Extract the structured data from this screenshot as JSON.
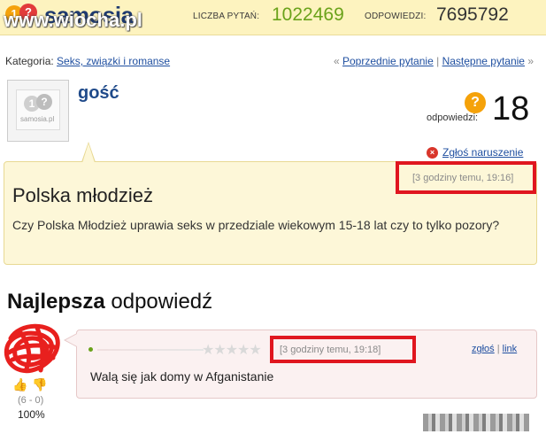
{
  "header": {
    "logo_badges": [
      "1",
      "?"
    ],
    "logo_text": "samosia",
    "watermark": "www.wiocha.pl",
    "questions_label": "LICZBA PYTAŃ:",
    "questions_count": "1022469",
    "answers_label": "ODPOWIEDZI:",
    "answers_count": "7695792"
  },
  "category": {
    "label": "Kategoria:",
    "value": "Seks, związki i romanse"
  },
  "nav": {
    "prefix": "«",
    "prev": "Poprzednie pytanie",
    "separator": "|",
    "next": "Następne pytanie",
    "suffix": "»"
  },
  "asker": {
    "name": "gość",
    "avatar_text": "samosia.pl",
    "avatar_badges": [
      "1",
      "?"
    ]
  },
  "answers": {
    "icon": "?",
    "label": "odpowiedzi:",
    "count": "18"
  },
  "report": {
    "icon": "×",
    "label": "Zgłoś naruszenie"
  },
  "question": {
    "timestamp": "[3 godziny temu, 19:16]",
    "title": "Polska młodzież",
    "body": "Czy Polska Młodzież uprawia seks w przedziale wiekowym 15-18 lat czy to tylko pozory?"
  },
  "best_answer": {
    "heading_bold": "Najlepsza",
    "heading_rest": "odpowiedź",
    "stars": "★★★★★",
    "timestamp": "[3 godziny temu, 19:18]",
    "report_link": "zgłoś",
    "link_sep": "|",
    "link": "link",
    "body": "Walą się jak domy w Afganistanie",
    "thumb_up": "👍",
    "thumb_down": "👎",
    "votes": "(6 - 0)",
    "percent": "100%"
  },
  "colors": {
    "header_bg": "#fdf3bf",
    "green_count": "#6aa21a",
    "highlight": "#e0161f",
    "link": "#1f4fa0"
  }
}
